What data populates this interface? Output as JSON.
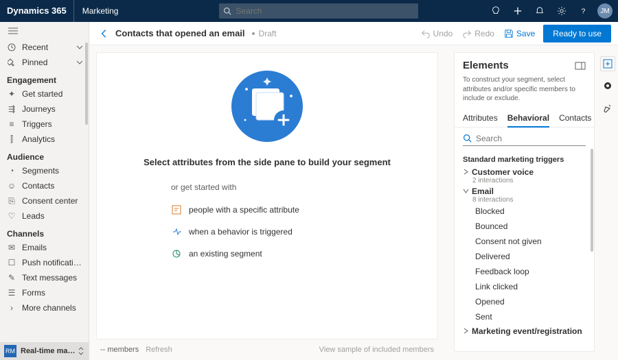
{
  "top": {
    "brand": "Dynamics 365",
    "area": "Marketing",
    "search_placeholder": "Search",
    "avatar": "JM"
  },
  "nav": {
    "recent": "Recent",
    "pinned": "Pinned",
    "sections": {
      "engagement": {
        "title": "Engagement",
        "items": [
          "Get started",
          "Journeys",
          "Triggers",
          "Analytics"
        ]
      },
      "audience": {
        "title": "Audience",
        "items": [
          "Segments",
          "Contacts",
          "Consent center",
          "Leads"
        ]
      },
      "channels": {
        "title": "Channels",
        "items": [
          "Emails",
          "Push notifications",
          "Text messages",
          "Forms",
          "More channels"
        ]
      }
    },
    "footer_badge": "RM",
    "footer_label": "Real-time marketi…"
  },
  "cmd": {
    "title": "Contacts that opened an email",
    "status": "Draft",
    "undo": "Undo",
    "redo": "Redo",
    "save": "Save",
    "ready": "Ready to use"
  },
  "canvas": {
    "heading": "Select attributes from the side pane to build your segment",
    "sub": "or get started with",
    "opt1": "people with a specific attribute",
    "opt2": "when a behavior is triggered",
    "opt3": "an existing segment"
  },
  "panel": {
    "title": "Elements",
    "hint": "To construct your segment, select attributes and/or specific members to include or exclude.",
    "tabs": {
      "attributes": "Attributes",
      "behavioral": "Behavioral",
      "contacts": "Contacts"
    },
    "search_placeholder": "Search",
    "std_header": "Standard marketing triggers",
    "cv": {
      "label": "Customer voice",
      "meta": "2 interactions"
    },
    "email": {
      "label": "Email",
      "meta": "8 interactions",
      "items": [
        "Blocked",
        "Bounced",
        "Consent not given",
        "Delivered",
        "Feedback loop",
        "Link clicked",
        "Opened",
        "Sent"
      ]
    },
    "mer": "Marketing event/registration"
  },
  "bottom": {
    "members": "-- members",
    "refresh": "Refresh",
    "sample": "View sample of included members"
  }
}
